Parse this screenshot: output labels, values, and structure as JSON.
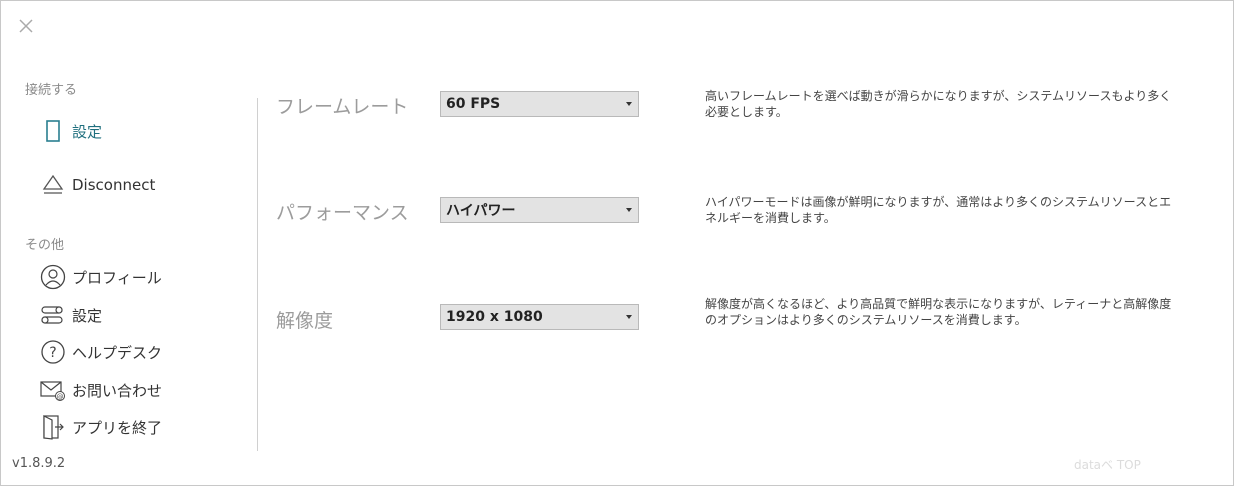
{
  "window": {
    "close_icon": "close-icon",
    "version": "v1.8.9.2",
    "watermark": "dataベ TOP"
  },
  "sidebar": {
    "connect_header": "接続する",
    "connect_items": [
      {
        "label": "設定",
        "icon": "device-icon",
        "active": true
      },
      {
        "label": "Disconnect",
        "icon": "eject-icon",
        "active": false
      }
    ],
    "other_header": "その他",
    "other_items": [
      {
        "label": "プロフィール",
        "icon": "profile-icon"
      },
      {
        "label": "設定",
        "icon": "toggle-settings-icon"
      },
      {
        "label": "ヘルプデスク",
        "icon": "help-icon"
      },
      {
        "label": "お問い合わせ",
        "icon": "mail-icon"
      },
      {
        "label": "アプリを終了",
        "icon": "exit-icon"
      }
    ]
  },
  "settings": [
    {
      "label": "フレームレート",
      "value": "60 FPS",
      "description": "高いフレームレートを選べば動きが滑らかになりますが、システムリソースもより多く必要とします。"
    },
    {
      "label": "パフォーマンス",
      "value": "ハイパワー",
      "description": "ハイパワーモードは画像が鮮明になりますが、通常はより多くのシステムリソースとエネルギーを消費します。"
    },
    {
      "label": "解像度",
      "value": "1920 x 1080",
      "description": "解像度が高くなるほど、より高品質で鮮明な表示になりますが、レティーナと高解像度のオプションはより多くのシステムリソースを消費します。"
    }
  ],
  "colors": {
    "accent": "#1f6f7e",
    "dropdown_bg": "#e3e3e3",
    "label_gray": "#9c9c9c"
  }
}
